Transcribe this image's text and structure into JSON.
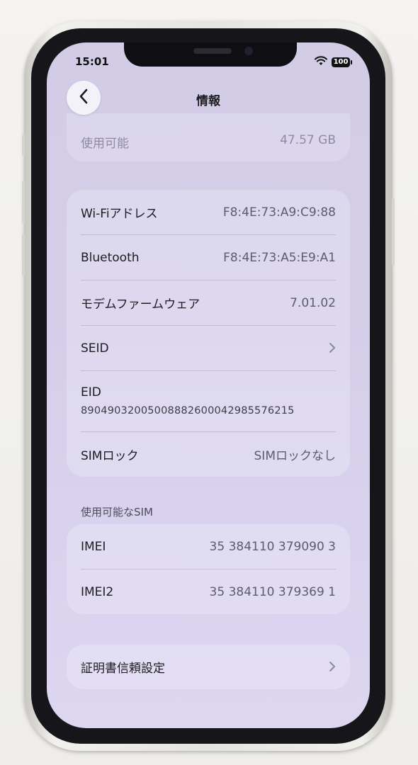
{
  "status_bar": {
    "time": "15:01",
    "battery": "100"
  },
  "nav": {
    "title": "情報"
  },
  "storage_row": {
    "label": "使用可能",
    "value": "47.57 GB"
  },
  "network_card": {
    "rows": [
      {
        "label": "Wi-Fiアドレス",
        "value": "F8:4E:73:A9:C9:88"
      },
      {
        "label": "Bluetooth",
        "value": "F8:4E:73:A5:E9:A1"
      },
      {
        "label": "モデムファームウェア",
        "value": "7.01.02"
      },
      {
        "label": "SEID",
        "value": ""
      },
      {
        "label": "EID",
        "value": "89049032005008882600042985576215"
      },
      {
        "label": "SIMロック",
        "value": "SIMロックなし"
      }
    ]
  },
  "sim_section": {
    "header": "使用可能なSIM",
    "rows": [
      {
        "label": "IMEI",
        "value": "35 384110 379090 3"
      },
      {
        "label": "IMEI2",
        "value": "35 384110 379369 1"
      }
    ]
  },
  "cert_card": {
    "label": "証明書信頼設定"
  },
  "icons": {
    "back": "chevron-left-icon",
    "disclosure": "chevron-right-icon",
    "wifi": "wifi-icon",
    "battery": "battery-icon"
  }
}
